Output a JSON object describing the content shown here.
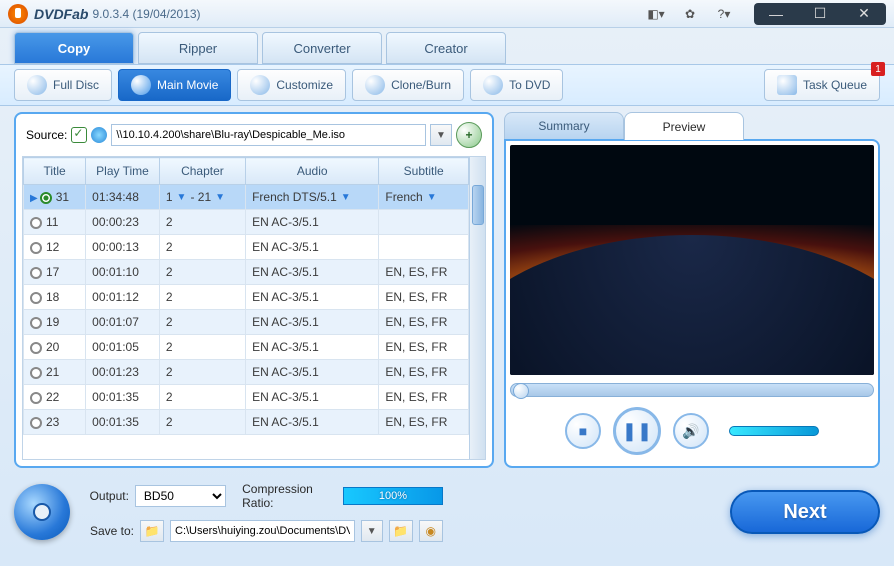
{
  "app": {
    "name": "DVDFab",
    "version": "9.0.3.4 (19/04/2013)"
  },
  "titlebar_icons": {
    "contrast": "◧▾",
    "gear": "✿",
    "help": "?▾"
  },
  "win": {
    "min": "—",
    "max": "☐",
    "close": "✕"
  },
  "main_tabs": [
    {
      "label": "Copy",
      "active": true
    },
    {
      "label": "Ripper",
      "active": false
    },
    {
      "label": "Converter",
      "active": false
    },
    {
      "label": "Creator",
      "active": false
    }
  ],
  "toolbar": [
    {
      "label": "Full Disc",
      "active": false
    },
    {
      "label": "Main Movie",
      "active": true
    },
    {
      "label": "Customize",
      "active": false
    },
    {
      "label": "Clone/Burn",
      "active": false
    },
    {
      "label": "To DVD",
      "active": false
    }
  ],
  "task_queue": {
    "label": "Task Queue",
    "badge": "1"
  },
  "source": {
    "label": "Source:",
    "path": "\\\\10.10.4.200\\share\\Blu-ray\\Despicable_Me.iso",
    "add": "+"
  },
  "columns": [
    "Title",
    "Play Time",
    "Chapter",
    "Audio",
    "Subtitle"
  ],
  "selected_row": {
    "title": "31",
    "play_time": "01:34:48",
    "chap_from": "1",
    "chap_to": "21",
    "audio": "French DTS/5.1",
    "subtitle": "French"
  },
  "rows": [
    {
      "title": "11",
      "play_time": "00:00:23",
      "chapter": "2",
      "audio": "EN AC-3/5.1",
      "subtitle": ""
    },
    {
      "title": "12",
      "play_time": "00:00:13",
      "chapter": "2",
      "audio": "EN AC-3/5.1",
      "subtitle": ""
    },
    {
      "title": "17",
      "play_time": "00:01:10",
      "chapter": "2",
      "audio": "EN AC-3/5.1",
      "subtitle": "EN, ES, FR"
    },
    {
      "title": "18",
      "play_time": "00:01:12",
      "chapter": "2",
      "audio": "EN AC-3/5.1",
      "subtitle": "EN, ES, FR"
    },
    {
      "title": "19",
      "play_time": "00:01:07",
      "chapter": "2",
      "audio": "EN AC-3/5.1",
      "subtitle": "EN, ES, FR"
    },
    {
      "title": "20",
      "play_time": "00:01:05",
      "chapter": "2",
      "audio": "EN AC-3/5.1",
      "subtitle": "EN, ES, FR"
    },
    {
      "title": "21",
      "play_time": "00:01:23",
      "chapter": "2",
      "audio": "EN AC-3/5.1",
      "subtitle": "EN, ES, FR"
    },
    {
      "title": "22",
      "play_time": "00:01:35",
      "chapter": "2",
      "audio": "EN AC-3/5.1",
      "subtitle": "EN, ES, FR"
    },
    {
      "title": "23",
      "play_time": "00:01:35",
      "chapter": "2",
      "audio": "EN AC-3/5.1",
      "subtitle": "EN, ES, FR"
    }
  ],
  "preview_tabs": {
    "summary": "Summary",
    "preview": "Preview"
  },
  "controls": {
    "stop": "■",
    "pause": "❚❚",
    "volume": "🔊"
  },
  "output": {
    "label": "Output:",
    "value": "BD50",
    "ratio_label": "Compression Ratio:",
    "ratio": "100%"
  },
  "save": {
    "label": "Save to:",
    "path": "C:\\Users\\huiying.zou\\Documents\\DVDFab"
  },
  "next": "Next"
}
